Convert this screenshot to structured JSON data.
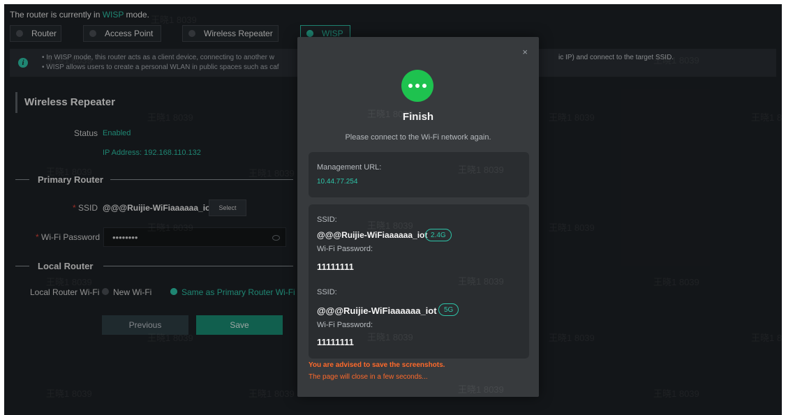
{
  "mode_status": {
    "prefix": "The router is currently in",
    "mode": "WISP",
    "suffix": "mode."
  },
  "mode_tabs": [
    {
      "label": "Router"
    },
    {
      "label": "Access Point"
    },
    {
      "label": "Wireless Repeater"
    },
    {
      "label": "WISP"
    }
  ],
  "info": {
    "line1_left": "In WISP mode, this router acts as a client device, connecting to another w",
    "line1_right": "ic IP) and connect to the target SSID.",
    "line2_left": "WISP allows users to create a personal WLAN in public spaces such as caf"
  },
  "section_title": "Wireless Repeater",
  "status": {
    "label": "Status",
    "value": "Enabled",
    "ip": "IP Address: 192.168.110.132"
  },
  "primary_router": {
    "title": "Primary Router",
    "ssid_label": "SSID",
    "ssid_value": "@@@Ruijie-WiFiaaaaaa_iot",
    "select_label": "Select",
    "password_label": "Wi-Fi Password",
    "password_value": "••••••••"
  },
  "local_router": {
    "title": "Local Router",
    "wifi_label": "Local Router Wi-Fi",
    "option_new": "New Wi-Fi",
    "option_same": "Same as Primary Router Wi-Fi"
  },
  "buttons": {
    "previous": "Previous",
    "save": "Save"
  },
  "watermark": "王晓1 8039",
  "modal": {
    "close": "×",
    "title": "Finish",
    "subtitle": "Please connect to the Wi-Fi network again.",
    "management_url_label": "Management URL:",
    "management_url": "10.44.77.254",
    "networks": [
      {
        "ssid_label": "SSID:",
        "ssid": "@@@Ruijie-WiFiaaaaaa_iot",
        "band": "2.4G",
        "password_label": "Wi-Fi Password:",
        "password": "11111111"
      },
      {
        "ssid_label": "SSID:",
        "ssid": "@@@Ruijie-WiFiaaaaaa_iot",
        "band": "5G",
        "password_label": "Wi-Fi Password:",
        "password": "11111111"
      }
    ],
    "advice": "You are advised to save the screenshots.",
    "closing_notice": "The page will close in a few seconds..."
  },
  "colors": {
    "accent": "#2ec4a8",
    "success": "#1ec24f",
    "warning": "#ff6a2b",
    "background": "#1d2125"
  }
}
